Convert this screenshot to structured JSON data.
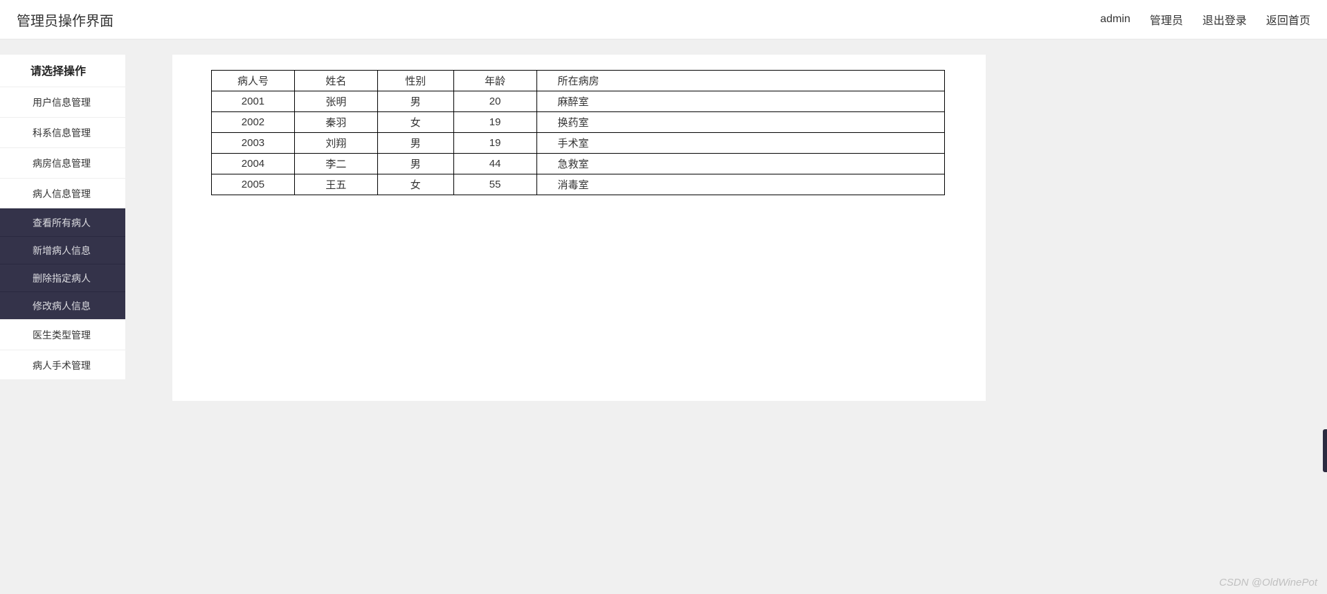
{
  "topbar": {
    "title": "管理员操作界面",
    "links": {
      "user": "admin",
      "role": "管理员",
      "logout": "退出登录",
      "home": "返回首页"
    }
  },
  "sidebar": {
    "header": "请选择操作",
    "items": [
      {
        "label": "用户信息管理"
      },
      {
        "label": "科系信息管理"
      },
      {
        "label": "病房信息管理"
      },
      {
        "label": "病人信息管理"
      }
    ],
    "subitems": [
      {
        "label": "查看所有病人"
      },
      {
        "label": "新增病人信息"
      },
      {
        "label": "删除指定病人"
      },
      {
        "label": "修改病人信息"
      }
    ],
    "items2": [
      {
        "label": "医生类型管理"
      },
      {
        "label": "病人手术管理"
      }
    ]
  },
  "table": {
    "headers": {
      "id": "病人号",
      "name": "姓名",
      "sex": "性别",
      "age": "年龄",
      "ward": "所在病房"
    },
    "rows": [
      {
        "id": "2001",
        "name": "张明",
        "sex": "男",
        "age": "20",
        "ward": "麻醉室"
      },
      {
        "id": "2002",
        "name": "秦羽",
        "sex": "女",
        "age": "19",
        "ward": "换药室"
      },
      {
        "id": "2003",
        "name": "刘翔",
        "sex": "男",
        "age": "19",
        "ward": "手术室"
      },
      {
        "id": "2004",
        "name": "李二",
        "sex": "男",
        "age": "44",
        "ward": "急救室"
      },
      {
        "id": "2005",
        "name": "王五",
        "sex": "女",
        "age": "55",
        "ward": "消毒室"
      }
    ]
  },
  "watermark": "CSDN @OldWinePot"
}
